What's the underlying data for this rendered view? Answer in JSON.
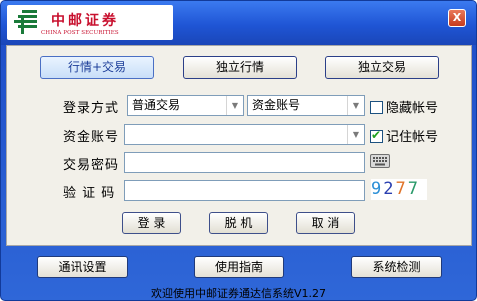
{
  "logo": {
    "chinese": "中邮证券",
    "english": "CHINA POST SECURITIES"
  },
  "close_label": "X",
  "tabs": [
    {
      "label": "行情+交易",
      "active": true
    },
    {
      "label": "独立行情",
      "active": false
    },
    {
      "label": "独立交易",
      "active": false
    }
  ],
  "login": {
    "mode_label": "登录方式",
    "mode_value": "普通交易",
    "account_type_value": "资金账号",
    "hide_account_label": "隐藏帐号",
    "hide_account_checked": false,
    "account_label": "资金账号",
    "account_value": "",
    "remember_label": "记住帐号",
    "remember_checked": true,
    "password_label": "交易密码",
    "password_value": "",
    "captcha_label": "验 证 码",
    "captcha_value": "",
    "captcha_code": [
      "9",
      "2",
      "7",
      "7"
    ],
    "captcha_colors": [
      "#2b8fd6",
      "#2a3fb0",
      "#e0742a",
      "#2a9a6a"
    ]
  },
  "actions": {
    "login": "登 录",
    "offline": "脱 机",
    "cancel": "取 消"
  },
  "bottom": {
    "comm_settings": "通讯设置",
    "user_guide": "使用指南",
    "system_check": "系统检测"
  },
  "footer": "欢迎使用中邮证券通达信系统V1.27"
}
